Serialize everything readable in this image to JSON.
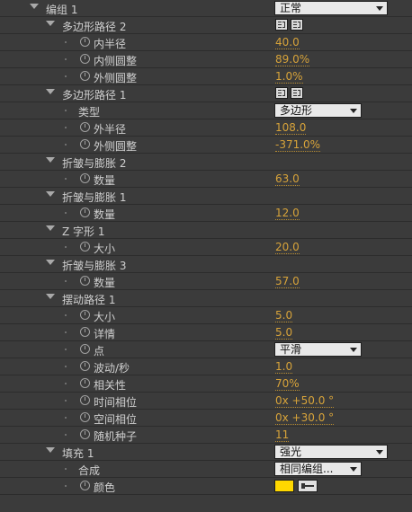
{
  "rows": {
    "group1": {
      "label": "编组 1",
      "blend": "正常"
    },
    "polypath2": {
      "label": "多边形路径 2"
    },
    "inner_radius": {
      "label": "内半径",
      "value": "40.0"
    },
    "inner_roundness": {
      "label": "内侧圆整",
      "value": "89.0%"
    },
    "outer_roundness": {
      "label": "外侧圆整",
      "value": "1.0%"
    },
    "polypath1": {
      "label": "多边形路径 1"
    },
    "type": {
      "label": "类型",
      "value": "多边形"
    },
    "outer_radius": {
      "label": "外半径",
      "value": "108.0"
    },
    "outer_roundness1": {
      "label": "外侧圆整",
      "value": "-371.0%"
    },
    "pucker2": {
      "label": "折皱与膨胀 2"
    },
    "amount2": {
      "label": "数量",
      "value": "63.0"
    },
    "pucker1": {
      "label": "折皱与膨胀 1"
    },
    "amount1": {
      "label": "数量",
      "value": "12.0"
    },
    "zigzag1": {
      "label": "Z 字形 1"
    },
    "size_z": {
      "label": "大小",
      "value": "20.0"
    },
    "pucker3": {
      "label": "折皱与膨胀 3"
    },
    "amount3": {
      "label": "数量",
      "value": "57.0"
    },
    "wiggle1": {
      "label": "摆动路径 1"
    },
    "size_w": {
      "label": "大小",
      "value": "5.0"
    },
    "detail": {
      "label": "详情",
      "value": "5.0"
    },
    "points": {
      "label": "点",
      "value": "平滑"
    },
    "wiggles": {
      "label": "波动/秒",
      "value": "1.0"
    },
    "correlation": {
      "label": "相关性",
      "value": "70%"
    },
    "temporal_phase": {
      "label": "时间相位",
      "value": "0x +50.0 °"
    },
    "spatial_phase": {
      "label": "空间相位",
      "value": "0x +30.0 °"
    },
    "seed": {
      "label": "随机种子",
      "value": "11"
    },
    "fill1": {
      "label": "填充 1",
      "blend": "强光"
    },
    "composite": {
      "label": "合成",
      "value": "相同编组..."
    },
    "color": {
      "label": "颜色",
      "value": "#ffd800"
    }
  },
  "colors": {
    "accent_value": "#d7a33a",
    "fill_color": "#ffd800"
  }
}
